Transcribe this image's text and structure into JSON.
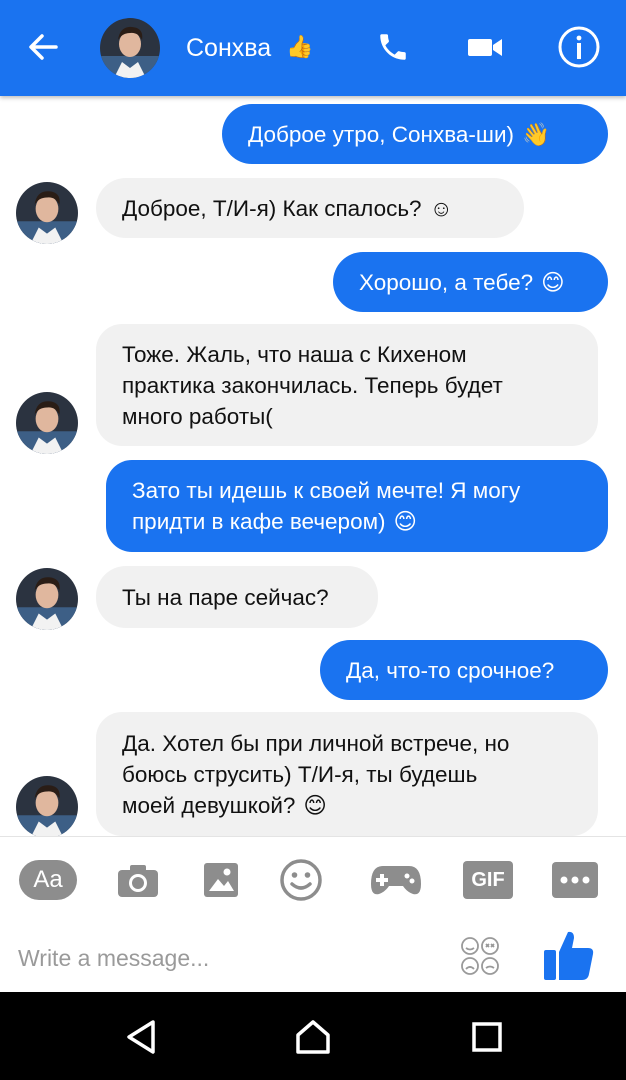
{
  "header": {
    "contact_name": "Сонхва",
    "name_emoji": "👍"
  },
  "messages": [
    {
      "side": "out",
      "text": "Доброе утро, Сонхва-ши)",
      "emoji": "👋"
    },
    {
      "side": "in",
      "text": "Доброе, Т/И-я) Как спалось?",
      "emoji": "☺"
    },
    {
      "side": "out",
      "text": "Хорошо, а тебе?",
      "emoji": "😊"
    },
    {
      "side": "in",
      "lines": [
        "Тоже. Жаль, что наша с Кихеном",
        "практика закончилась. Теперь будет",
        "много работы("
      ]
    },
    {
      "side": "out",
      "lines": [
        "Зато ты идешь к своей мечте! Я могу",
        "придти в кафе вечером)"
      ],
      "emoji": "😊"
    },
    {
      "side": "in",
      "text": "Ты на паре сейчас?"
    },
    {
      "side": "out",
      "text": "Да, что-то срочное?"
    },
    {
      "side": "in",
      "lines": [
        "Да. Хотел бы при личной встрече, но",
        "боюсь струсить) Т/И-я, ты будешь",
        "моей девушкой?"
      ],
      "emoji": "😊"
    }
  ],
  "toolbar": {
    "aa_label": "Aa",
    "gif_label": "GIF"
  },
  "composer": {
    "placeholder": "Write a message..."
  },
  "colors": {
    "accent": "#1a73f0",
    "incoming_bubble": "#f1f1f1"
  }
}
